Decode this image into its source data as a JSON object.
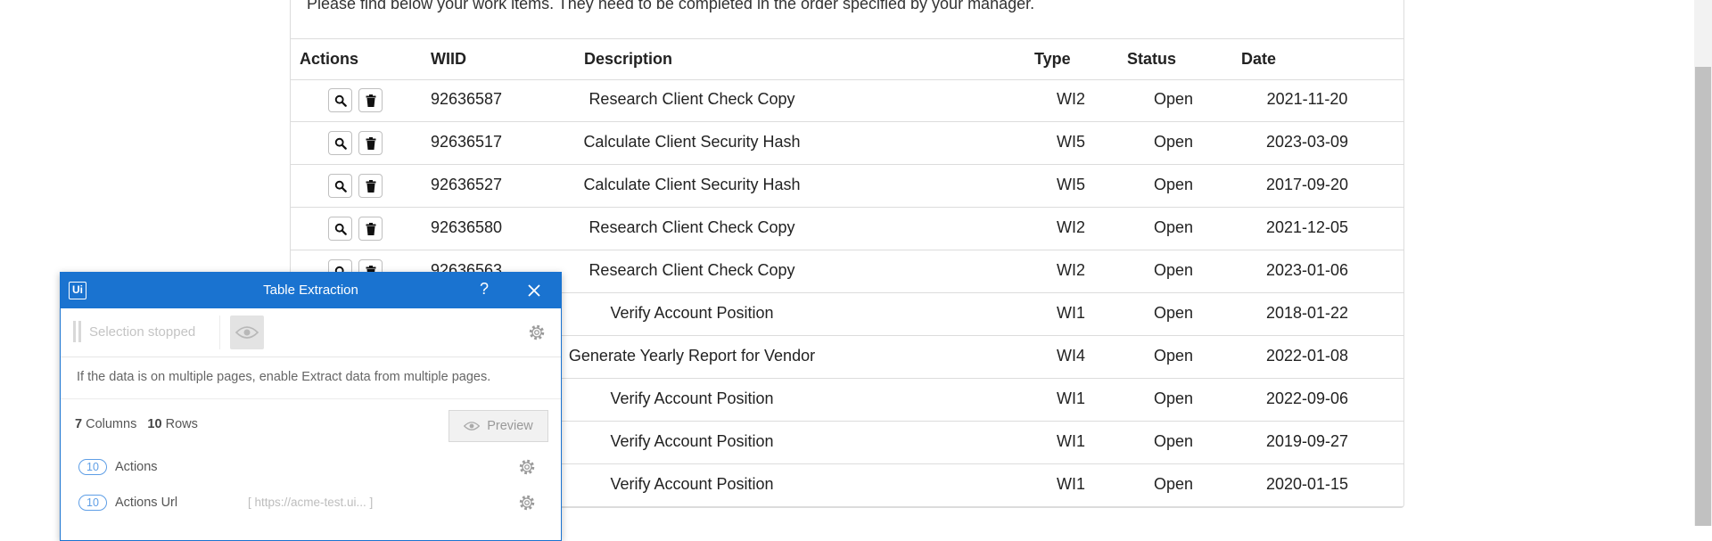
{
  "page": {
    "intro_text": "Please find below your work items. They need to be completed in the order specified by your manager."
  },
  "table": {
    "headers": {
      "actions": "Actions",
      "wiid": "WIID",
      "description": "Description",
      "type": "Type",
      "status": "Status",
      "date": "Date"
    },
    "rows": [
      {
        "wiid": "92636587",
        "description": "Research Client Check Copy",
        "type": "WI2",
        "status": "Open",
        "date": "2021-11-20"
      },
      {
        "wiid": "92636517",
        "description": "Calculate Client Security Hash",
        "type": "WI5",
        "status": "Open",
        "date": "2023-03-09"
      },
      {
        "wiid": "92636527",
        "description": "Calculate Client Security Hash",
        "type": "WI5",
        "status": "Open",
        "date": "2017-09-20"
      },
      {
        "wiid": "92636580",
        "description": "Research Client Check Copy",
        "type": "WI2",
        "status": "Open",
        "date": "2021-12-05"
      },
      {
        "wiid": "92636563",
        "description": "Research Client Check Copy",
        "type": "WI2",
        "status": "Open",
        "date": "2023-01-06"
      },
      {
        "wiid": "",
        "description": "Verify Account Position",
        "type": "WI1",
        "status": "Open",
        "date": "2018-01-22"
      },
      {
        "wiid": "",
        "description": "Generate Yearly Report for Vendor",
        "type": "WI4",
        "status": "Open",
        "date": "2022-01-08"
      },
      {
        "wiid": "",
        "description": "Verify Account Position",
        "type": "WI1",
        "status": "Open",
        "date": "2022-09-06"
      },
      {
        "wiid": "",
        "description": "Verify Account Position",
        "type": "WI1",
        "status": "Open",
        "date": "2019-09-27"
      },
      {
        "wiid": "",
        "description": "Verify Account Position",
        "type": "WI1",
        "status": "Open",
        "date": "2020-01-15"
      }
    ]
  },
  "dialog": {
    "logo": "Ui",
    "title": "Table Extraction",
    "help": "?",
    "selection_status": "Selection stopped",
    "info": "If the data is on multiple pages, enable Extract data from multiple pages.",
    "columns_count": "7",
    "columns_label": "Columns",
    "rows_count": "10",
    "rows_label": "Rows",
    "preview_label": "Preview",
    "columns": [
      {
        "count": "10",
        "name": "Actions",
        "sample": ""
      },
      {
        "count": "10",
        "name": "Actions Url",
        "sample": "[ https://acme-test.ui... ]"
      }
    ]
  },
  "colors": {
    "dialog_accent": "#1a73d0",
    "pill_border": "#5e9ee6"
  }
}
